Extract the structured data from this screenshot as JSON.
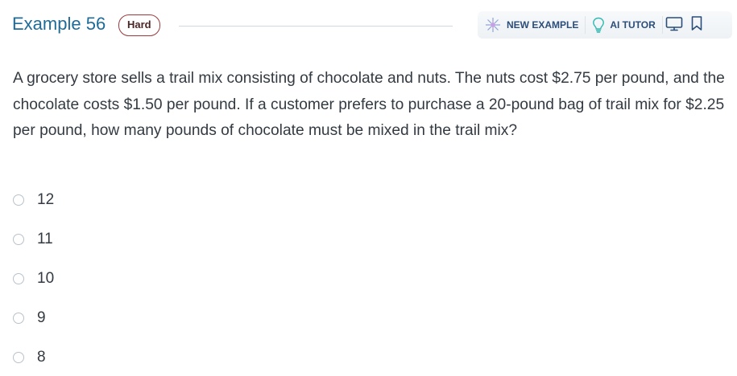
{
  "header": {
    "title": "Example 56",
    "difficulty": "Hard",
    "new_example_label": "NEW EXAMPLE",
    "ai_tutor_label": "AI TUTOR"
  },
  "icons": {
    "new_example": "sparkle-icon",
    "ai_tutor": "lightbulb-icon",
    "whiteboard": "monitor-icon",
    "bookmark": "bookmark-icon"
  },
  "colors": {
    "title": "#1f6b99",
    "difficulty_border": "#9c3b3b",
    "toolbar_text": "#2b4d7a",
    "body_text": "#333a42"
  },
  "question": {
    "text": "A grocery store sells a trail mix consisting of chocolate and nuts. The nuts cost $2.75 per pound, and the chocolate costs $1.50 per pound. If a customer prefers to purchase a 20-pound bag of trail mix for $2.25 per pound, how many pounds of chocolate must be mixed in the trail mix?"
  },
  "options": [
    {
      "label": "12"
    },
    {
      "label": "11"
    },
    {
      "label": "10"
    },
    {
      "label": "9"
    },
    {
      "label": "8"
    }
  ]
}
